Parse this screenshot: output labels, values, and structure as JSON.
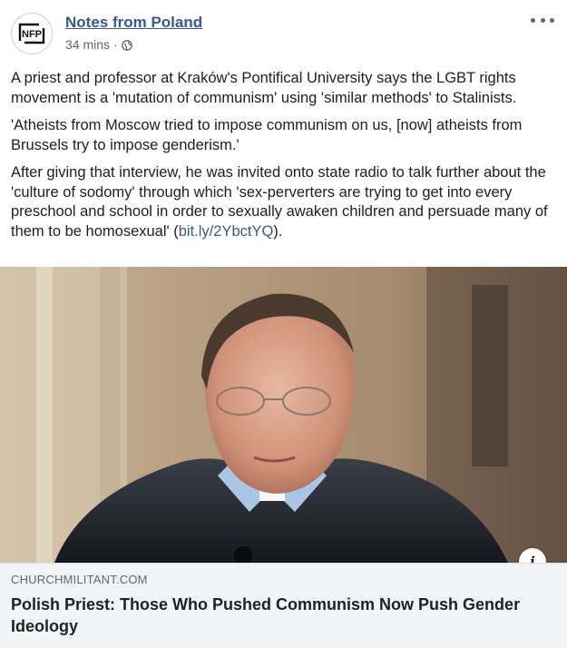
{
  "post": {
    "page_name": "Notes from Poland",
    "avatar_text": "NFP",
    "timestamp": "34 mins",
    "separator": "·",
    "privacy_icon": "globe-icon",
    "menu_icon": "more-options-icon",
    "paragraphs": [
      "A priest and professor at Kraków's Pontifical University says the LGBT rights movement is a 'mutation of communism' using 'similar methods' to Stalinists.",
      "'Atheists from Moscow tried to impose communism on us, [now] atheists from Brussels try to impose genderism.'"
    ],
    "paragraph3_text": "After giving that interview, he was invited onto state radio to talk further about the 'culture of sodomy' through which 'sex-perverters are trying to get into every preschool and school in order to sexually awaken children and persuade many of them to be homosexual' (",
    "paragraph3_link": "bit.ly/2YbctYQ",
    "paragraph3_end": ")."
  },
  "link_preview": {
    "info_label": "i",
    "domain": "CHURCHMILITANT.COM",
    "title": "Polish Priest: Those Who Pushed Communism Now Push Gender Ideology"
  },
  "colors": {
    "link": "#365899",
    "card_background": "#f2f3f5",
    "meta_text": "#606770"
  }
}
